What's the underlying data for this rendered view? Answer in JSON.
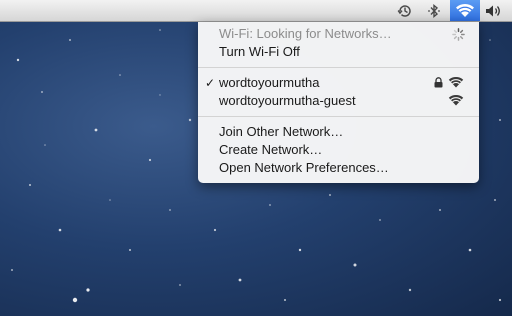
{
  "menubar": {
    "icons": [
      "time-machine-icon",
      "bluetooth-icon",
      "wifi-icon",
      "volume-icon"
    ],
    "active_color": "#3a7bea"
  },
  "wifi_menu": {
    "status_label": "Wi-Fi: Looking for Networks…",
    "toggle_label": "Turn Wi-Fi Off",
    "networks": [
      {
        "name": "wordtoyourmutha",
        "connected": true,
        "locked": true,
        "signal": "full"
      },
      {
        "name": "wordtoyourmutha-guest",
        "connected": false,
        "locked": false,
        "signal": "full"
      }
    ],
    "actions": [
      {
        "label": "Join Other Network…"
      },
      {
        "label": "Create Network…"
      },
      {
        "label": "Open Network Preferences…"
      }
    ],
    "checkmark": "✓"
  }
}
